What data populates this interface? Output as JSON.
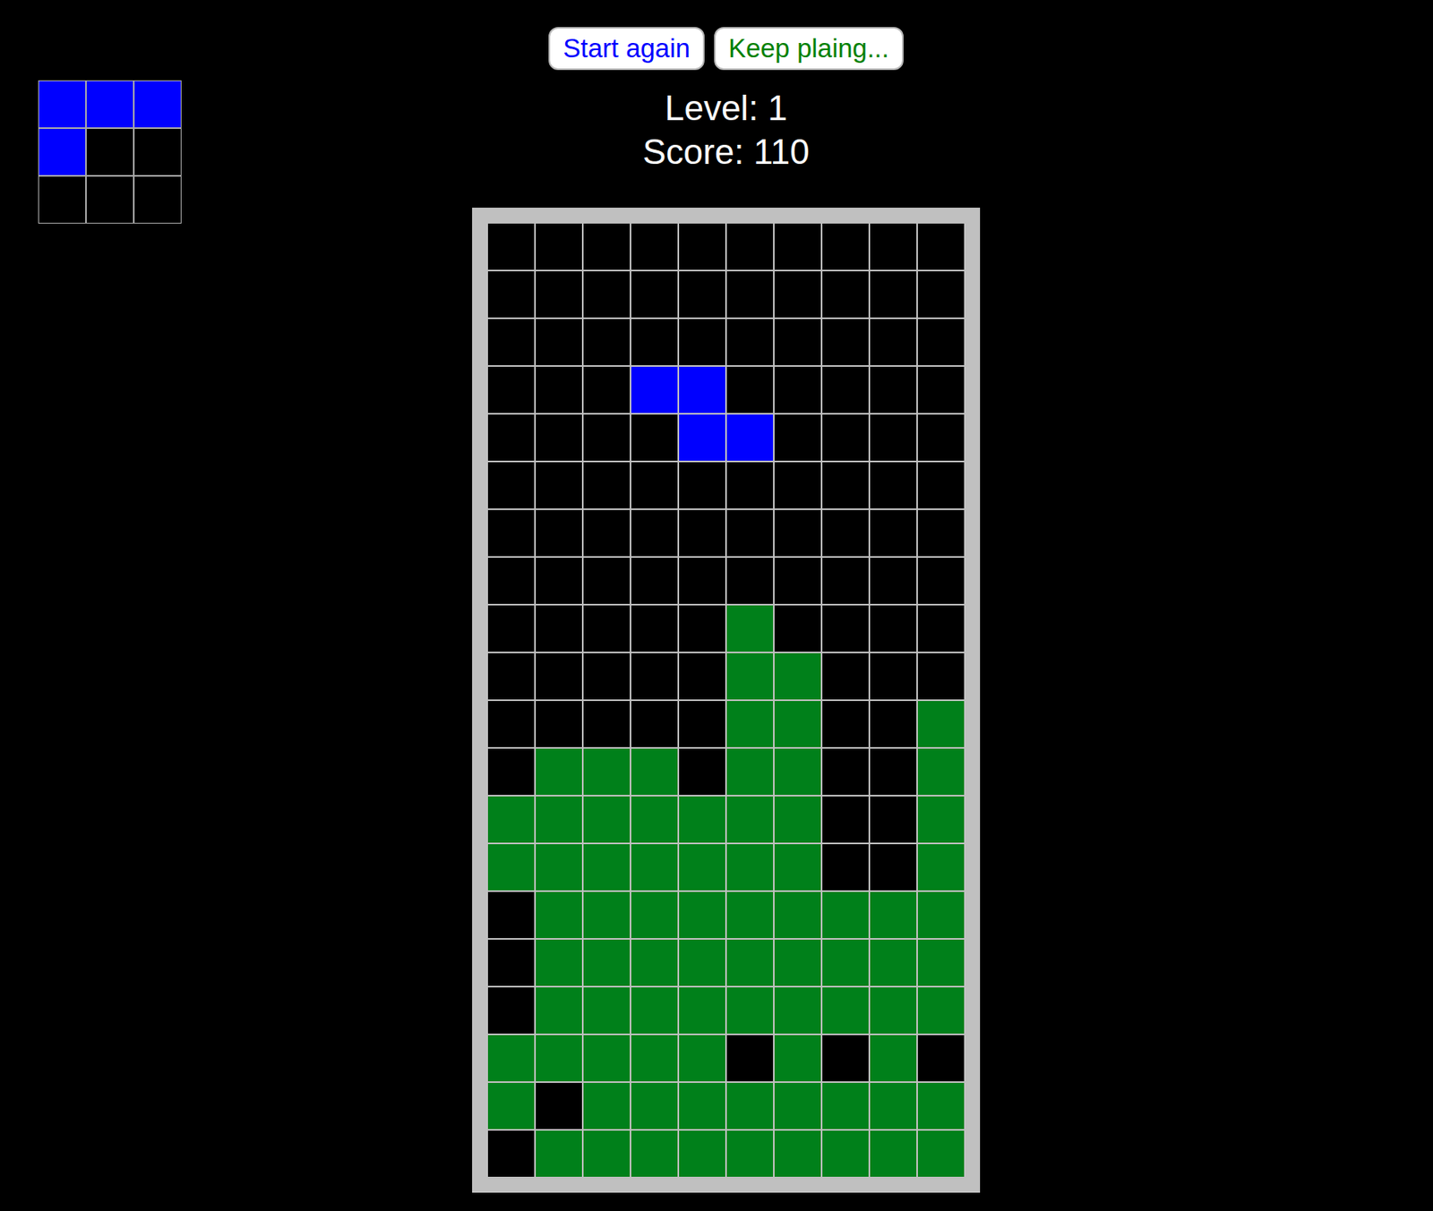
{
  "buttons": [
    {
      "label": "Start again",
      "color": "#0000ff"
    },
    {
      "label": "Keep plaing...",
      "color": "#008000"
    }
  ],
  "level": "Level: 1",
  "score": "Score: 110",
  "legend": {
    ".": {
      "kind": "empty",
      "color": "#000000"
    },
    "G": {
      "kind": "settled",
      "color": "#00801a"
    },
    "B": {
      "kind": "active",
      "color": "#0000ff"
    }
  },
  "next_piece": {
    "rows": [
      "BBB",
      "B..",
      "..."
    ]
  },
  "board": {
    "rows": [
      "..........",
      "..........",
      "..........",
      "...BB.....",
      "....BB....",
      "..........",
      "..........",
      "..........",
      ".....G....",
      ".....GG...",
      ".....GG..G",
      ".GGG.GG..G",
      "GGGGGGG..G",
      "GGGGGGG..G",
      ".GGGGGGGGG",
      ".GGGGGGGGG",
      ".GGGGGGGGG",
      "GGGGG.G.G.",
      "G.GGGGGGGG",
      ".GGGGGGGGG"
    ]
  }
}
